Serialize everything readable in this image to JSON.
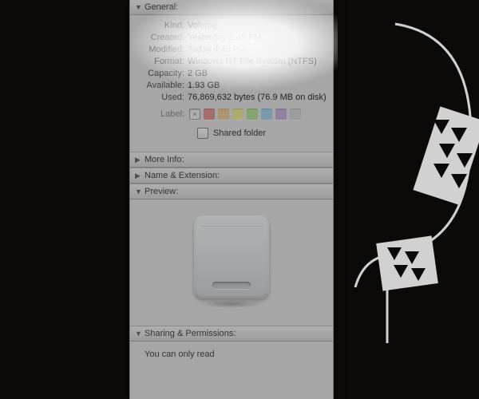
{
  "sections": {
    "general": {
      "title": "General:"
    },
    "more_info": {
      "title": "More Info:"
    },
    "name_ext": {
      "title": "Name & Extension:"
    },
    "preview": {
      "title": "Preview:"
    },
    "sharing": {
      "title": "Sharing & Permissions:"
    }
  },
  "general": {
    "kind_label": "Kind:",
    "kind_value": "Volume",
    "created_label": "Created:",
    "created_value": "Yesterday 2:46 PM",
    "modified_label": "Modified:",
    "modified_value": "Today 4:45 PM",
    "format_label": "Format:",
    "format_value": "Windows NT File System (NTFS)",
    "capacity_label": "Capacity:",
    "capacity_value": "2 GB",
    "available_label": "Available:",
    "available_value": "1.93 GB",
    "used_label": "Used:",
    "used_value": "76,869,632 bytes (76.9 MB on disk)",
    "label_label": "Label:",
    "label_none_glyph": "×",
    "label_colors": [
      "#e79899",
      "#f2cf9e",
      "#f2ee9e",
      "#b9e59e",
      "#a9d7f2",
      "#c9b4e2",
      "#d8d8d8"
    ]
  },
  "shared_folder": {
    "label": "Shared folder",
    "checked": false
  },
  "sharing": {
    "message": "You can only read"
  }
}
